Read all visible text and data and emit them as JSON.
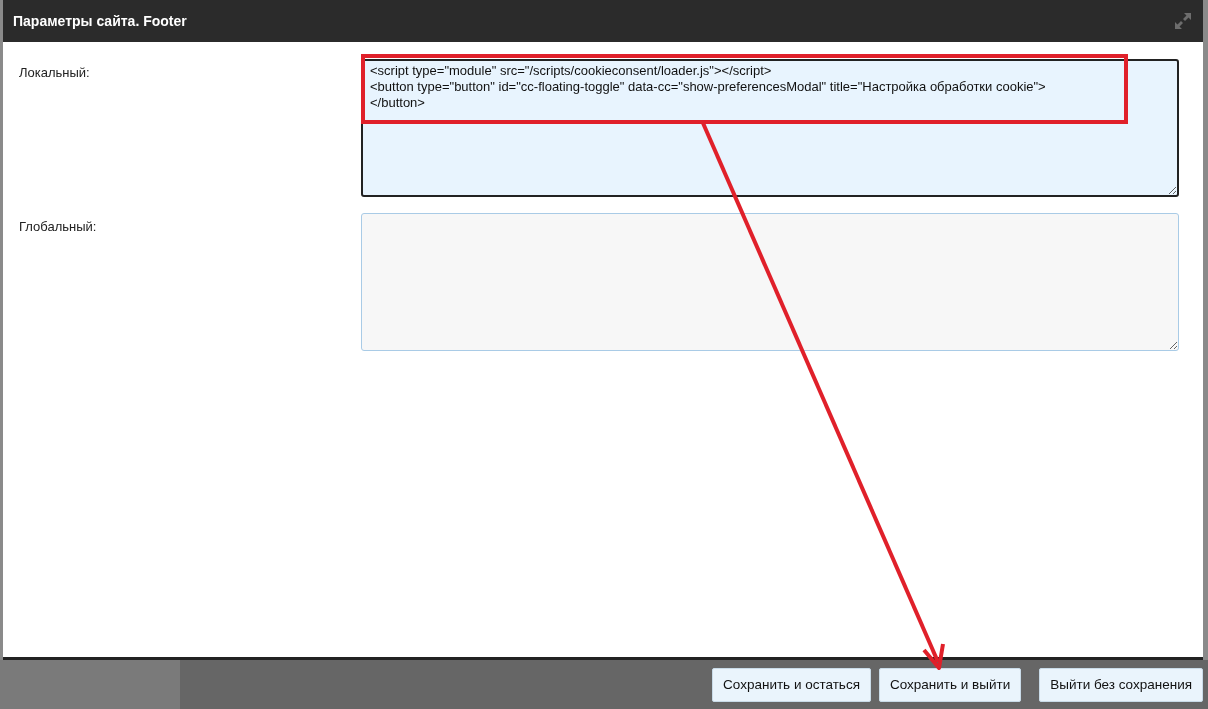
{
  "window": {
    "title": "Параметры сайта. Footer"
  },
  "fields": [
    {
      "label": "Локальный:",
      "value": "<script type=\"module\" src=\"/scripts/cookieconsent/loader.js\"></script>\n<button type=\"button\" id=\"cc-floating-toggle\" data-cc=\"show-preferencesModal\" title=\"Настройка обработки cookie\">\n</button>",
      "focused": true
    },
    {
      "label": "Глобальный:",
      "focused": false
    }
  ],
  "buttons": [
    "Сохранить и остаться",
    "Сохранить и выйти",
    "Выйти без сохранения"
  ]
}
